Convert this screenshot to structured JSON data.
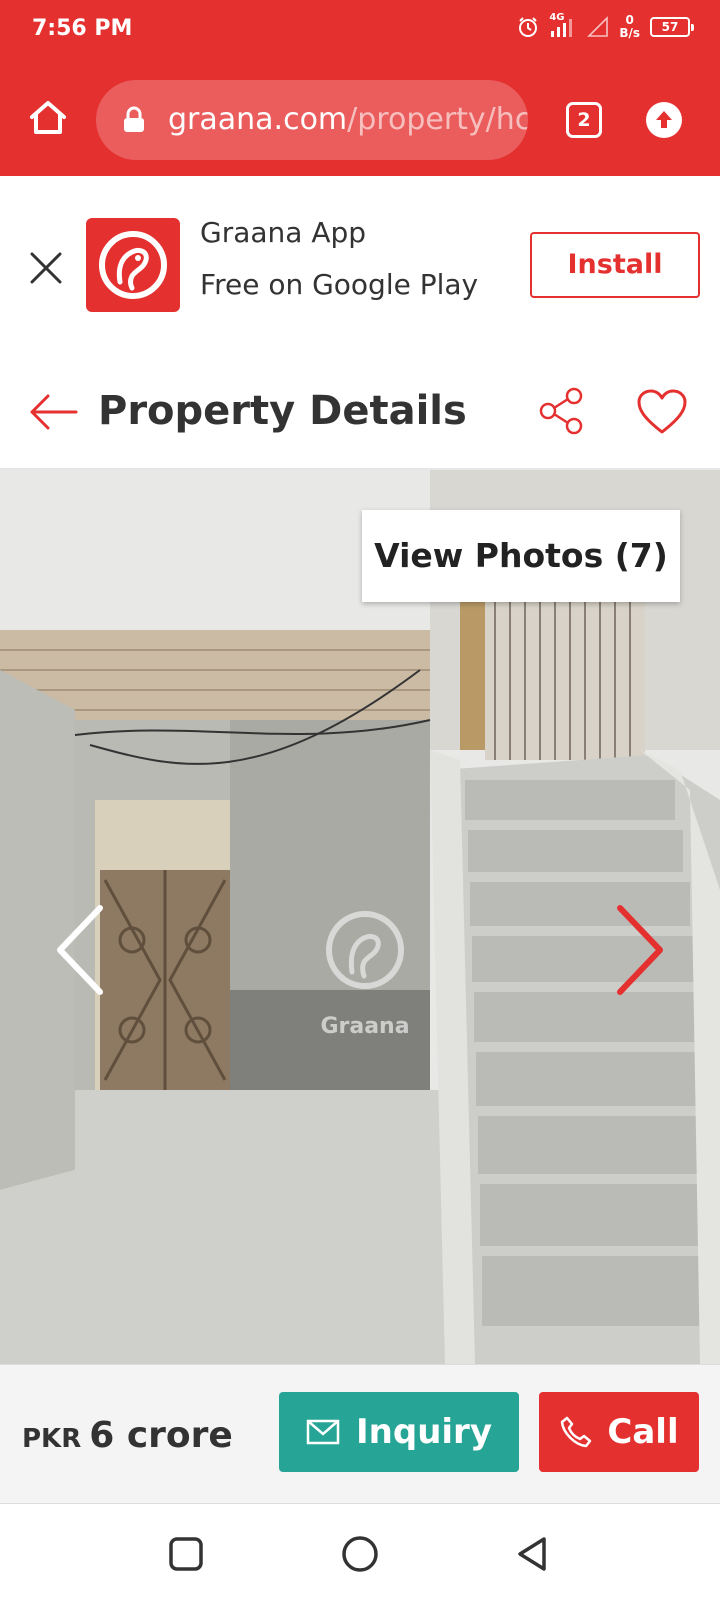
{
  "status_bar": {
    "time": "7:56 PM",
    "network": "4G",
    "speed_value": "0",
    "speed_unit": "B/s",
    "battery": "57"
  },
  "browser": {
    "url_domain": "graana.com",
    "url_path": "/property/hc",
    "tab_count": "2"
  },
  "app_banner": {
    "app_name": "Graana App",
    "subtitle": "Free on Google Play",
    "install_label": "Install"
  },
  "header": {
    "title": "Property Details"
  },
  "gallery": {
    "view_photos_label": "View Photos (7)",
    "watermark_text": "Graana"
  },
  "action_bar": {
    "currency": "PKR",
    "price": "6 crore",
    "inquiry_label": "Inquiry",
    "call_label": "Call"
  },
  "colors": {
    "brand_red": "#e4302f",
    "inquiry_teal": "#26a596"
  },
  "icons": [
    "home-icon",
    "lock-icon",
    "upload-icon",
    "close-icon",
    "graana-logo-icon",
    "back-arrow-icon",
    "share-icon",
    "heart-icon",
    "chevron-left-icon",
    "chevron-right-icon",
    "mail-icon",
    "phone-icon",
    "square-icon",
    "circle-icon",
    "triangle-back-icon"
  ]
}
